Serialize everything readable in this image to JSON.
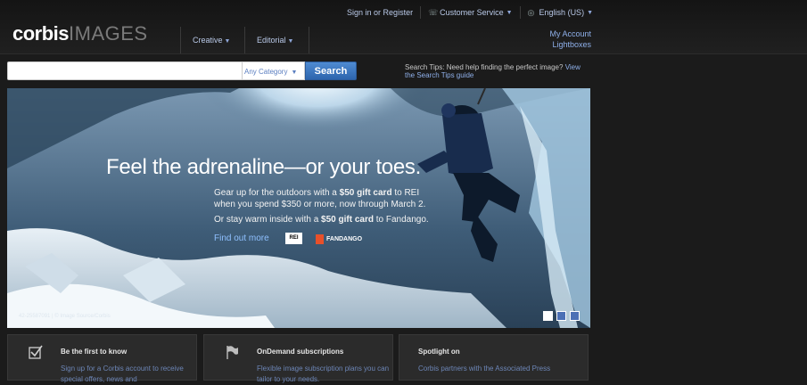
{
  "header": {
    "logo_primary": "corbis",
    "logo_secondary": "IMAGES",
    "utility": {
      "sign_in": "Sign in or Register",
      "customer_service": "Customer Service",
      "language": "English (US)"
    },
    "nav": [
      {
        "label": "Creative"
      },
      {
        "label": "Editorial"
      }
    ],
    "account": {
      "my_account": "My Account",
      "lightboxes": "Lightboxes"
    }
  },
  "search": {
    "value": "",
    "category": "Any Category",
    "button_label": "Search",
    "tips_text": "Search Tips: Need help finding the perfect image?",
    "tips_link": "View the Search Tips guide"
  },
  "hero": {
    "headline": "Feel the adrenaline—or your toes.",
    "body_line1_pre": "Gear up for the outdoors with a ",
    "body_line1_bold": "$50 gift card",
    "body_line1_post": " to REI when you spend $350 or more, now through March 2.",
    "body_line2_pre": "Or stay warm inside with a ",
    "body_line2_bold": "$50 gift card",
    "body_line2_post": " to Fandango.",
    "find_out_more": "Find out more",
    "rei_logo": "REI",
    "fandango_logo": "FANDANGO",
    "credit": "42-25587091 | © Image Source/Corbis",
    "slides_total": 3,
    "slide_active": 1
  },
  "panels": [
    {
      "icon": "checkbox-icon",
      "title": "Be the first to know",
      "desc": "Sign up for a Corbis account to receive special offers, news and"
    },
    {
      "icon": "flag-icon",
      "title": "OnDemand subscriptions",
      "desc": "Flexible image subscription plans you can tailor to your needs."
    },
    {
      "icon": "",
      "title": "Spotlight on",
      "desc": "Corbis partners with the Associated Press"
    }
  ],
  "colors": {
    "background": "#1b1b1b",
    "link": "#8fb0ea",
    "search_button": "#3a74bf"
  }
}
